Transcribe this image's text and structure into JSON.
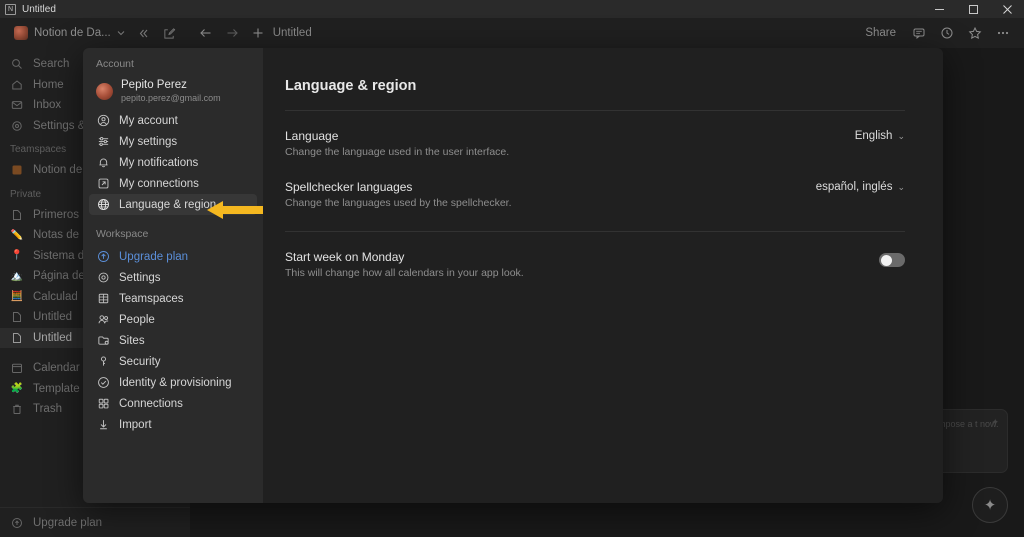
{
  "window": {
    "title": "Untitled",
    "app_icon": "notion-icon",
    "controls": {
      "minimize": "minimize-icon",
      "maximize": "maximize-icon",
      "close": "close-icon"
    }
  },
  "toolbar": {
    "workspace_name": "Notion de Da...",
    "chevron": "chevron-down-icon",
    "collapse": "collapse-sidebar-icon",
    "new_page": "new-page-icon",
    "back": "back-arrow-icon",
    "forward": "forward-arrow-icon",
    "add": "plus-icon",
    "tab_title": "Untitled",
    "share_label": "Share",
    "comment": "comment-icon",
    "history": "clock-icon",
    "favorite": "star-icon",
    "more": "more-horizontal-icon"
  },
  "sidebar": {
    "top_items": [
      {
        "label": "Search",
        "icon": "search-icon"
      },
      {
        "label": "Home",
        "icon": "home-icon"
      },
      {
        "label": "Inbox",
        "icon": "inbox-icon"
      },
      {
        "label": "Settings &",
        "icon": "gear-icon"
      }
    ],
    "teamspaces_label": "Teamspaces",
    "teamspaces": [
      {
        "label": "Notion de",
        "icon": "orange-square-icon"
      }
    ],
    "private_label": "Private",
    "private": [
      {
        "label": "Primeros",
        "icon": "page-icon"
      },
      {
        "label": "Notas de",
        "icon": "pencil-icon"
      },
      {
        "label": "Sistema d",
        "icon": "pin-icon"
      },
      {
        "label": "Página de",
        "icon": "mountain-icon"
      },
      {
        "label": "Calculad",
        "icon": "abacus-icon"
      },
      {
        "label": "Untitled",
        "icon": "page-icon"
      },
      {
        "label": "Untitled",
        "icon": "page-icon",
        "selected": true
      }
    ],
    "bottom_items": [
      {
        "label": "Calendar",
        "icon": "calendar-icon"
      },
      {
        "label": "Template",
        "icon": "templates-icon"
      },
      {
        "label": "Trash",
        "icon": "trash-icon"
      }
    ],
    "footer": {
      "label": "Upgrade plan",
      "icon": "upgrade-icon"
    }
  },
  "settings_modal": {
    "account_section_label": "Account",
    "account": {
      "name": "Pepito Perez",
      "email": "pepito.perez@gmail.com",
      "avatar": "user-avatar"
    },
    "account_items": [
      {
        "label": "My account",
        "icon": "person-circle-icon"
      },
      {
        "label": "My settings",
        "icon": "sliders-icon"
      },
      {
        "label": "My notifications",
        "icon": "bell-icon"
      },
      {
        "label": "My connections",
        "icon": "external-link-icon"
      },
      {
        "label": "Language & region",
        "icon": "globe-icon",
        "active": true
      }
    ],
    "workspace_section_label": "Workspace",
    "workspace_items": [
      {
        "label": "Upgrade plan",
        "icon": "upgrade-circle-icon",
        "accent": true
      },
      {
        "label": "Settings",
        "icon": "gear-icon"
      },
      {
        "label": "Teamspaces",
        "icon": "building-icon"
      },
      {
        "label": "People",
        "icon": "people-icon"
      },
      {
        "label": "Sites",
        "icon": "sites-icon"
      },
      {
        "label": "Security",
        "icon": "key-icon"
      },
      {
        "label": "Identity & provisioning",
        "icon": "shield-check-icon"
      },
      {
        "label": "Connections",
        "icon": "grid-icon"
      },
      {
        "label": "Import",
        "icon": "download-icon"
      }
    ],
    "page_title": "Language & region",
    "rows": [
      {
        "title": "Language",
        "description": "Change the language used in the user interface.",
        "control": "dropdown",
        "value": "English"
      },
      {
        "title": "Spellchecker languages",
        "description": "Change the languages used by the spellchecker.",
        "control": "dropdown",
        "value": "español, inglés"
      },
      {
        "title": "Start week on Monday",
        "description": "This will change how all calendars in your app look.",
        "control": "toggle",
        "value": "off"
      }
    ]
  },
  "overlay": {
    "ai_card_text": "d compose a t now.",
    "ai_fab_icon": "sparkle-icon"
  },
  "annotation": {
    "arrow": "left-pointing-arrow",
    "color": "#F5B820"
  }
}
